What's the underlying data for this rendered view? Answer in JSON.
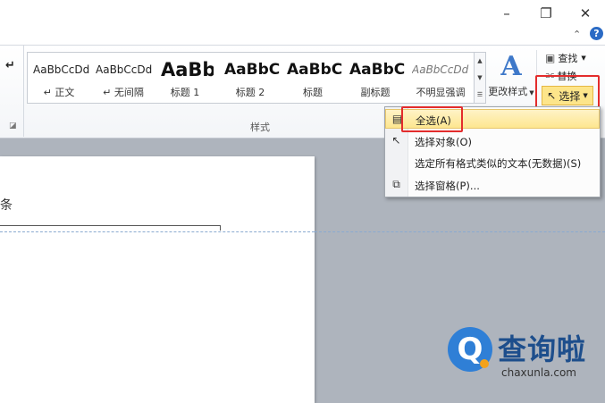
{
  "window": {
    "minimize_icon": "minimize-icon",
    "restore_icon": "restore-icon",
    "close_icon": "close-icon"
  },
  "ribbon": {
    "collapse_icon": "chevron-up-icon",
    "help_icon": "help-icon",
    "left_glyph": "↵",
    "styles": [
      {
        "sample": "AaBbCcDd",
        "name": "↵ 正文"
      },
      {
        "sample": "AaBbCcDd",
        "name": "↵ 无间隔"
      },
      {
        "sample": "AaBb",
        "name": "标题 1"
      },
      {
        "sample": "AaBbC",
        "name": "标题 2"
      },
      {
        "sample": "AaBbC",
        "name": "标题"
      },
      {
        "sample": "AaBbC",
        "name": "副标题"
      },
      {
        "sample": "AaBbCcDd",
        "name": "不明显强调"
      }
    ],
    "group_label": "样式",
    "change_style": {
      "icon_letter": "A",
      "label": "更改样式"
    },
    "editing": {
      "find_label": "查找",
      "replace_label": "替换",
      "select_label": "选择"
    }
  },
  "dropdown": {
    "items": [
      {
        "label": "全选(A)",
        "icon": "select-all-icon"
      },
      {
        "label": "选择对象(O)",
        "icon": "cursor-icon"
      },
      {
        "label": "选定所有格式类似的文本(无数据)(S)",
        "icon": ""
      },
      {
        "label": "选择窗格(P)...",
        "icon": "selection-pane-icon"
      }
    ]
  },
  "document": {
    "fragment_text": "条"
  },
  "watermark": {
    "title": "查询啦",
    "url": "chaxunla.com",
    "logo_letter": "Q"
  },
  "colors": {
    "highlight_red": "#e32c2c",
    "select_button_bg": "#fde58a",
    "brand_blue": "#2f7fd6"
  }
}
